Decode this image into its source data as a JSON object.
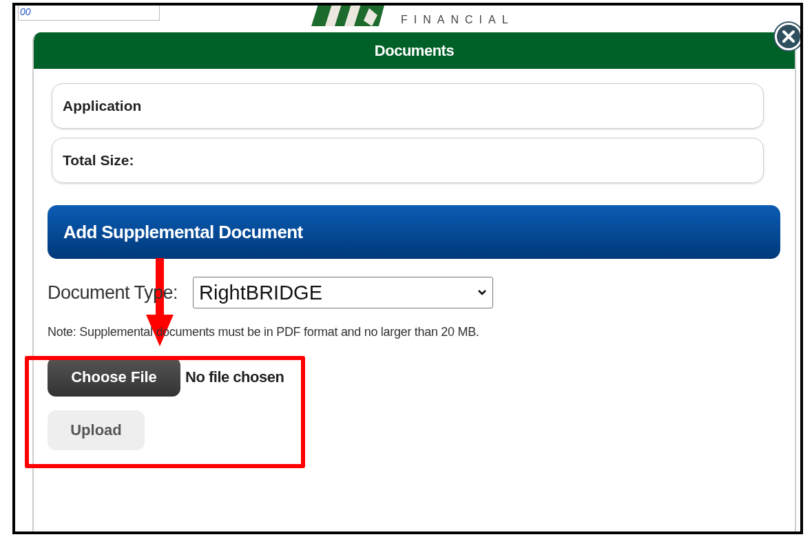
{
  "background_field": {
    "value": "00"
  },
  "logo": {
    "text": "FINANCIAL"
  },
  "dialog": {
    "title": "Documents"
  },
  "info_boxes": [
    {
      "label": "Application"
    },
    {
      "label": "Total Size:"
    }
  ],
  "section": {
    "title": "Add Supplemental Document"
  },
  "document_type": {
    "label": "Document Type:",
    "value": "RightBRIDGE"
  },
  "note": "Note: Supplemental documents must be in PDF format and no larger than 20 MB.",
  "file_input": {
    "button": "Choose File",
    "status": "No file chosen"
  },
  "upload_button": {
    "label": "Upload",
    "disabled": true
  }
}
